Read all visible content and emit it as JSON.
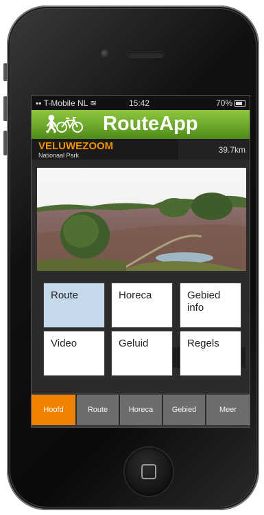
{
  "status_bar": {
    "carrier": "T-Mobile NL",
    "time": "15:42",
    "battery": "70%"
  },
  "app": {
    "title": "RouteApp"
  },
  "location": {
    "name": "VELUWEZOOM",
    "subtitle": "Nationaal Park",
    "distance": "39.7km"
  },
  "tiles": [
    {
      "label": "Route",
      "active": true
    },
    {
      "label": "Horeca",
      "active": false
    },
    {
      "label": "Gebied info",
      "active": false
    },
    {
      "label": "Video",
      "active": false
    },
    {
      "label": "Geluid",
      "active": false
    },
    {
      "label": "Regels",
      "active": false
    }
  ],
  "tabs": [
    {
      "label": "Hoofd",
      "active": true
    },
    {
      "label": "Route",
      "active": false
    },
    {
      "label": "Horeca",
      "active": false
    },
    {
      "label": "Gebied",
      "active": false
    },
    {
      "label": "Meer",
      "active": false
    }
  ],
  "colors": {
    "app_green": "#7ab733",
    "accent_orange": "#f08200",
    "tile_active": "#c6d9ea"
  }
}
